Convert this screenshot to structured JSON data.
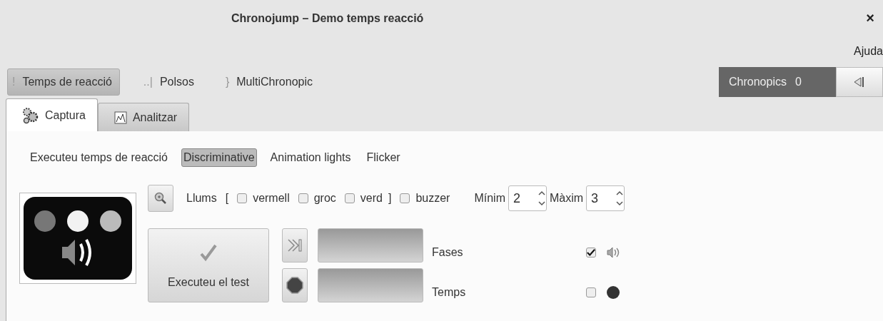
{
  "window": {
    "title": "Chronojump – Demo temps reacció",
    "close": "×"
  },
  "menu": [
    "Ajuda"
  ],
  "modes": [
    {
      "icon": "!",
      "label": "Temps de reacció",
      "selected": true
    },
    {
      "icon": "..|",
      "label": "Polsos",
      "selected": false
    },
    {
      "icon": "}",
      "label": "MultiChronopic",
      "selected": false
    }
  ],
  "chronopics": {
    "label": "Chronopics",
    "count": "0"
  },
  "tabs": [
    {
      "label": "Captura",
      "selected": true
    },
    {
      "label": "Analitzar",
      "selected": false
    }
  ],
  "subtypes": [
    {
      "label": "Executeu temps de reacció",
      "selected": false
    },
    {
      "label": "Discriminative",
      "selected": true
    },
    {
      "label": "Animation lights",
      "selected": false
    },
    {
      "label": "Flicker",
      "selected": false
    }
  ],
  "lights": {
    "label": "Llums",
    "open": "[",
    "close": "]",
    "options": [
      {
        "label": "vermell",
        "checked": false
      },
      {
        "label": "groc",
        "checked": false
      },
      {
        "label": "verd",
        "checked": false
      }
    ],
    "buzzer": {
      "label": "buzzer",
      "checked": false
    }
  },
  "minimum": {
    "label": "Mínim",
    "value": "2"
  },
  "maximum": {
    "label": "Màxim",
    "value": "3"
  },
  "execute_button": "Executeu el test",
  "rows": [
    {
      "label": "Fases",
      "kind": "sound",
      "checked": true
    },
    {
      "label": "Temps",
      "kind": "dot",
      "checked": false
    }
  ]
}
